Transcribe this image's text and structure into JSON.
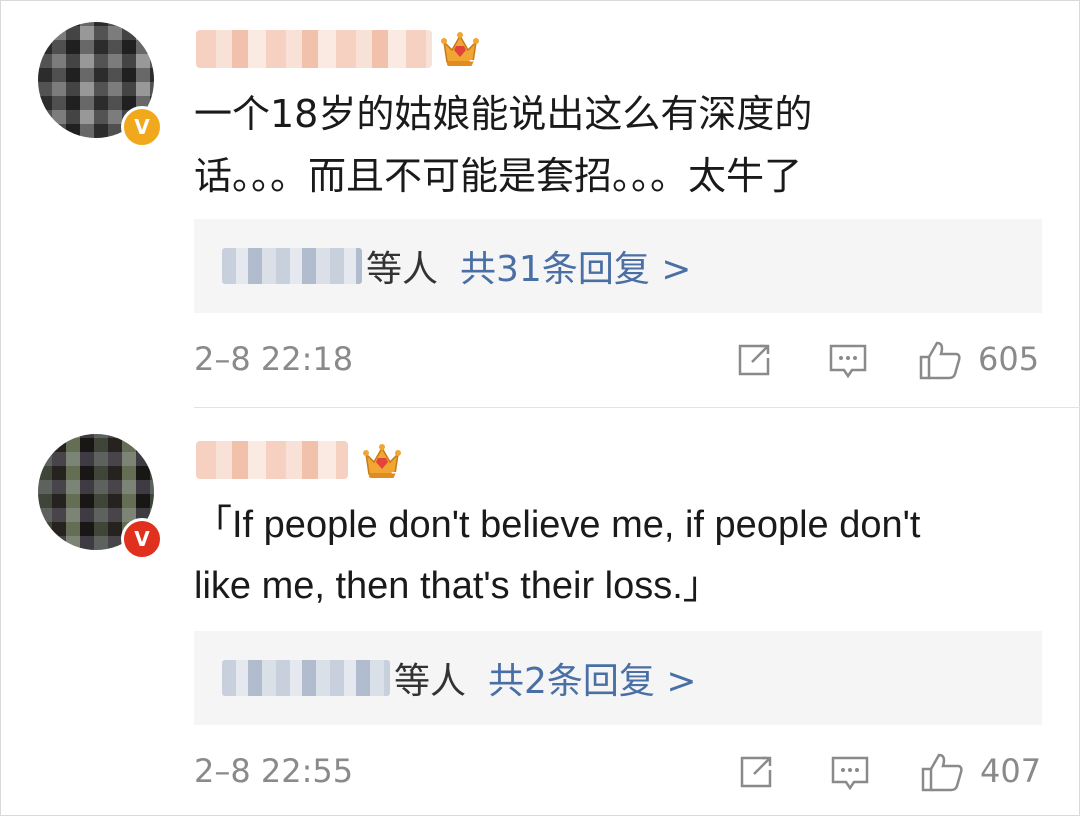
{
  "comments": [
    {
      "badge": "V",
      "badge_color": "#f2a81c",
      "crown_level": "7",
      "lines": [
        "一个18岁的姑娘能说出这么有深度的",
        "话。。。而且不可能是套招。。。太牛了"
      ],
      "reply_suffix": "等人",
      "reply_link": "共31条回复 >",
      "time": "2–8 22:18",
      "likes": "605"
    },
    {
      "badge": "V",
      "badge_color": "#e0301e",
      "crown_level": "7",
      "lines": [
        "「If people don't believe me, if people don't",
        "like me, then that's their loss.」"
      ],
      "reply_suffix": "等人",
      "reply_link": "共2条回复 >",
      "time": "2–8 22:55",
      "likes": "407"
    }
  ],
  "icons": [
    "share-icon",
    "comment-icon",
    "like-icon",
    "crown-icon"
  ],
  "colors": {
    "link": "#4a6fa5",
    "meta": "#8a8a8a",
    "reply_bg": "#f5f5f5"
  }
}
